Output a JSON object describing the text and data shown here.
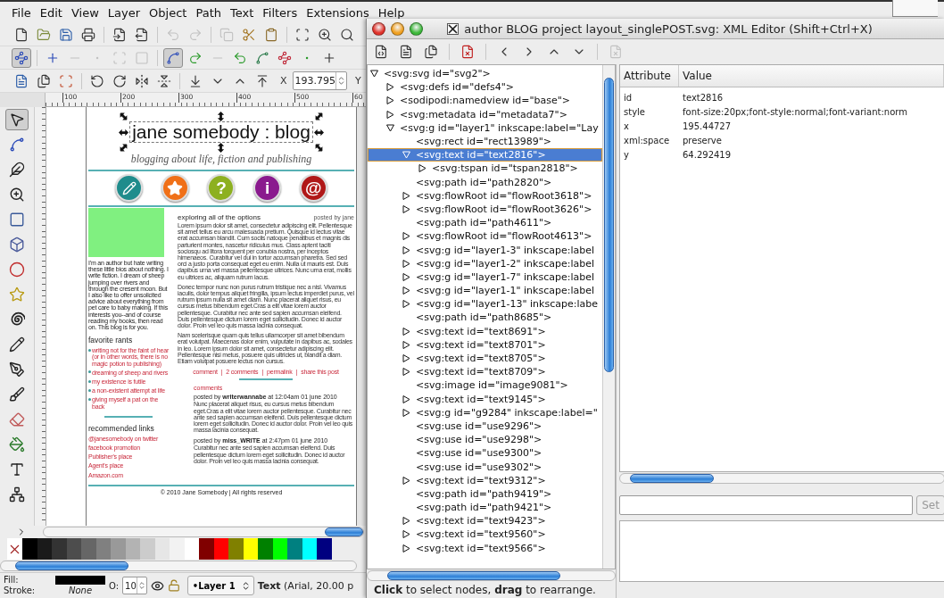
{
  "menu": [
    "File",
    "Edit",
    "View",
    "Layer",
    "Object",
    "Path",
    "Text",
    "Filters",
    "Extensions",
    "Help"
  ],
  "toolbar_main": [
    [
      {
        "kind": "new",
        "disabled": false
      },
      {
        "kind": "open",
        "disabled": false
      },
      {
        "kind": "save",
        "disabled": false
      },
      {
        "kind": "print",
        "disabled": false
      }
    ],
    [
      {
        "kind": "import",
        "disabled": false
      },
      {
        "kind": "export",
        "disabled": false
      }
    ],
    [
      {
        "kind": "undo",
        "disabled": true
      },
      {
        "kind": "redo",
        "disabled": true
      }
    ],
    [
      {
        "kind": "duplicate",
        "disabled": true
      },
      {
        "kind": "cut",
        "disabled": false
      },
      {
        "kind": "paste",
        "disabled": false
      }
    ],
    [
      {
        "kind": "zoom_selection",
        "disabled": false
      },
      {
        "kind": "zoom_drawing",
        "disabled": false
      },
      {
        "kind": "zoom_page",
        "disabled": false
      }
    ]
  ],
  "toolbar_node": [
    [
      {
        "kind": "node_edit",
        "pressed": true,
        "disabled": false
      }
    ],
    [
      {
        "kind": "insert_node",
        "pressed": false,
        "disabled": false
      },
      {
        "kind": "delete_node",
        "pressed": false,
        "disabled": true
      },
      {
        "kind": "join_nodes",
        "pressed": false,
        "disabled": true
      },
      {
        "kind": "break_nodes",
        "pressed": false,
        "disabled": true
      },
      {
        "kind": "join_segment",
        "pressed": false,
        "disabled": true
      }
    ],
    [
      {
        "kind": "cusp_node",
        "pressed": true,
        "disabled": false
      },
      {
        "kind": "smooth_node",
        "pressed": false,
        "disabled": false
      },
      {
        "kind": "symmetric_node",
        "pressed": false,
        "disabled": true
      },
      {
        "kind": "auto_node",
        "pressed": false,
        "disabled": false
      },
      {
        "kind": "to_line",
        "pressed": false,
        "disabled": false
      },
      {
        "kind": "to_curve",
        "pressed": false,
        "disabled": false
      },
      {
        "kind": "add_node",
        "pressed": false,
        "disabled": false
      },
      {
        "kind": "center_node",
        "pressed": false,
        "disabled": false
      }
    ]
  ],
  "toolbar_select": {
    "groups": [
      [
        {
          "kind": "select_all"
        },
        {
          "kind": "select_all_layers"
        },
        {
          "kind": "deselect"
        }
      ],
      [
        {
          "kind": "rotate_ccw"
        },
        {
          "kind": "rotate_cw"
        },
        {
          "kind": "flip_h"
        },
        {
          "kind": "flip_v"
        }
      ],
      [
        {
          "kind": "lower_bottom"
        },
        {
          "kind": "lower"
        },
        {
          "kind": "raise"
        },
        {
          "kind": "raise_top"
        }
      ]
    ],
    "x_label": "X",
    "x_value": "193.795",
    "y_label": "Y"
  },
  "ruler_labels": [
    "100",
    "200",
    "300",
    "400",
    "500",
    "60"
  ],
  "toolbox": [
    {
      "kind": "selector",
      "selected": true
    },
    {
      "kind": "node",
      "selected": false
    },
    {
      "kind": "tweak",
      "selected": false
    },
    {
      "kind": "zoom",
      "selected": false
    },
    {
      "kind": "rect",
      "selected": false
    },
    {
      "kind": "box3d",
      "selected": false
    },
    {
      "kind": "ellipse",
      "selected": false
    },
    {
      "kind": "star",
      "selected": false
    },
    {
      "kind": "spiral",
      "selected": false
    },
    {
      "kind": "pencil",
      "selected": false
    },
    {
      "kind": "pen",
      "selected": false
    },
    {
      "kind": "calligraphy",
      "selected": false
    },
    {
      "kind": "eraser",
      "selected": false
    },
    {
      "kind": "bucket",
      "selected": false
    },
    {
      "kind": "text",
      "selected": false
    },
    {
      "kind": "connector",
      "selected": false
    }
  ],
  "page": {
    "title": "jane somebody : blog",
    "subtitle": "blogging about life, fiction and publishing",
    "nav_icons": [
      {
        "kind": "pencil",
        "color": "#1f8c8c"
      },
      {
        "kind": "star",
        "color": "#f07018"
      },
      {
        "kind": "glyph",
        "glyph": "?",
        "color": "#8db020"
      },
      {
        "kind": "glyph",
        "glyph": "i",
        "color": "#8a1a8e"
      },
      {
        "kind": "glyph",
        "glyph": "@",
        "color": "#b01818"
      }
    ],
    "bio": "I'm an author but hate writing these little bios about nothing. I write fiction. I dream of sheep jumping over rivers and through the cresent moon. But I also like to offer unsolicited advice about everything from pet care to baby making. If this interests you--and of course reading my books, then read on. This blog is for you.",
    "rants_heading": "favorite rants",
    "rants": [
      "writing not for the faint of hear (or in other words, there is no magic potion to publishing)",
      "dreaming of sheep and rivers",
      "my existence is futile",
      "a non-existent attempt at life",
      "giving myself a pat on the back"
    ],
    "links_heading": "recommended links",
    "links": [
      "@janesomebody on twitter",
      "facebook promotion",
      "Publisher's place",
      "Agent's place",
      "Amazon.com"
    ],
    "post_heading": "exploring all of the options",
    "post_byline": "posted by jane",
    "paragraphs": [
      "Lorem ipsum dolor sit amet, consectetur adipiscing elit. Pellentesque sit amet tellus eu arcu malesuada pretium. Quisque id lectus vitae erat accumsan blandit. Cum sociis natoque penatibus et magnis dis parturient montes, nascetur ridiculus mus. Class aptent taciti sociosqu ad litora torquent per conubia nostra, per inceptos himenaeos. Curabitur vel dui in tortor accumsan pharetra. Sed sed orci a justo porta consequat eget eu enim. Nulla ut mauris est. Duis dapibus urna vel massa pellentesque ultrices. Nunc urna erat, mollis eu ultrices ac, aliquam rutrum lacus.",
      "Donec tempor nunc non purus rutrum tristique nec a nisl. Vivamus iaculis, dolor tempus aliquet fringilla, ipsum lectus imperdiet purus, vel rutrum ipsum nulla sit amet diam. Nunc placerat aliquet risus, eu cursus metus bibendum eget.Cras a elit vitae lorem auctor pellentesque. Curabitur nec ante sed sapien accumsan eleifend. Duis pellentesque dictum lorem eget sollicitudin. Donec id auctor dolor. Proin vel leo quis massa lacinia consequat.",
      "Nam scelerisque quam quis tellus ullamcorper sit amet bibendum erat volutpat. Maecenas dolor enim, vulputate in dapibus ac, sodales in leo. Lorem ipsum dolor sit amet, consectetur adipiscing elit. Pellentesque nisi metus, posuere quis ultricies ut, blandit a diam. Etiam volutpat posuere lectus non cursus."
    ],
    "post_links": [
      "comment",
      "2 comments",
      "permalink",
      "share this post"
    ],
    "link_separator": "|",
    "comments_label": "comments",
    "comments": [
      {
        "byline": "posted by **writerwannabe** at 12:04am  01 june 2010",
        "body": "Nunc placerat aliquet risus, eu cursus metus bibendum eget.Cras a elit vitae lorem auctor pellentesque. Curabitur nec ante sed sapien accumsan eleifend. Duis pellentesque dictum lorem eget sollicitudin. Donec id auctor dolor. Proin vel leo quis massa lacinia consequat."
      },
      {
        "byline": "posted by **miss_WRITE** at 2:47pm  01 june 2010",
        "body": "Curabitur nec ante sed sapien accumsan eleifend. Duis pellentesque dictum lorem eget sollicitudin. Donec id auctor dolor. Proin vel leo quis massa lacinia consequat."
      }
    ],
    "footer": "© 2010 Jane Somebody  | All rights reserved"
  },
  "palette": [
    {
      "color": "#000000"
    },
    {
      "color": "#1a1a1a"
    },
    {
      "color": "#333333"
    },
    {
      "color": "#4d4d4d"
    },
    {
      "color": "#666666"
    },
    {
      "color": "#808080"
    },
    {
      "color": "#999999"
    },
    {
      "color": "#b3b3b3"
    },
    {
      "color": "#cccccc"
    },
    {
      "color": "#e6e6e6"
    },
    {
      "color": "#f2f2f2"
    },
    {
      "color": "#ffffff"
    },
    {
      "color": "#800000"
    },
    {
      "color": "#ff0000"
    },
    {
      "color": "#808000"
    },
    {
      "color": "#ffff00"
    },
    {
      "color": "#008000"
    },
    {
      "color": "#00ff00"
    },
    {
      "color": "#008080"
    },
    {
      "color": "#00ffff"
    },
    {
      "color": "#000080"
    }
  ],
  "status": {
    "fill_label": "Fill:",
    "stroke_label": "Stroke:",
    "fill": {
      "color": "#000000"
    },
    "stroke_value": "None",
    "opacity_label": "O:",
    "opacity_value": "10",
    "layer": "•Layer 1",
    "message": "**Text** (Arial, 20.00 p"
  },
  "dialog": {
    "title": "author BLOG project layout_singlePOST.svg: XML Editor (Shift+Ctrl+X)",
    "toolbar": [
      [
        {
          "kind": "new_element",
          "disabled": false
        },
        {
          "kind": "new_text",
          "disabled": false
        },
        {
          "kind": "duplicate_node",
          "disabled": false
        }
      ],
      [
        {
          "kind": "delete_node",
          "disabled": false
        }
      ],
      [
        {
          "kind": "unindent",
          "disabled": false
        },
        {
          "kind": "indent",
          "disabled": false
        },
        {
          "kind": "raise",
          "disabled": false
        },
        {
          "kind": "lower",
          "disabled": false
        }
      ],
      [
        {
          "kind": "node_properties",
          "disabled": true
        }
      ]
    ],
    "tree": [
      {
        "label": "<svg:svg id=\"svg2\">",
        "expandable": true,
        "expanded": true,
        "selected": false,
        "children": [
          {
            "label": "<svg:defs id=\"defs4\">",
            "expandable": true,
            "expanded": false,
            "selected": false
          },
          {
            "label": "<sodipodi:namedview id=\"base\">",
            "expandable": true,
            "expanded": false,
            "selected": false
          },
          {
            "label": "<svg:metadata id=\"metadata7\">",
            "expandable": true,
            "expanded": false,
            "selected": false
          },
          {
            "label": "<svg:g id=\"layer1\" inkscape:label=\"Lay",
            "expandable": true,
            "expanded": true,
            "selected": false,
            "children": [
              {
                "label": "<svg:rect id=\"rect13989\">",
                "expandable": false,
                "selected": false
              },
              {
                "label": "<svg:text id=\"text2816\">",
                "expandable": true,
                "expanded": true,
                "selected": true,
                "children": [
                  {
                    "label": "<svg:tspan id=\"tspan2818\">",
                    "expandable": true,
                    "expanded": false,
                    "selected": false
                  }
                ]
              },
              {
                "label": "<svg:path id=\"path2820\">",
                "expandable": false,
                "selected": false
              },
              {
                "label": "<svg:flowRoot id=\"flowRoot3618\">",
                "expandable": true,
                "expanded": false,
                "selected": false
              },
              {
                "label": "<svg:flowRoot id=\"flowRoot3626\">",
                "expandable": true,
                "expanded": false,
                "selected": false
              },
              {
                "label": "<svg:path id=\"path4611\">",
                "expandable": false,
                "selected": false
              },
              {
                "label": "<svg:flowRoot id=\"flowRoot4613\">",
                "expandable": true,
                "expanded": false,
                "selected": false
              },
              {
                "label": "<svg:g id=\"layer1-3\" inkscape:label",
                "expandable": true,
                "expanded": false,
                "selected": false
              },
              {
                "label": "<svg:g id=\"layer1-2\" inkscape:label",
                "expandable": true,
                "expanded": false,
                "selected": false
              },
              {
                "label": "<svg:g id=\"layer1-7\" inkscape:label",
                "expandable": true,
                "expanded": false,
                "selected": false
              },
              {
                "label": "<svg:g id=\"layer1-1\" inkscape:label",
                "expandable": true,
                "expanded": false,
                "selected": false
              },
              {
                "label": "<svg:g id=\"layer1-13\" inkscape:labe",
                "expandable": true,
                "expanded": false,
                "selected": false
              },
              {
                "label": "<svg:path id=\"path8685\">",
                "expandable": false,
                "selected": false
              },
              {
                "label": "<svg:text id=\"text8691\">",
                "expandable": true,
                "expanded": false,
                "selected": false
              },
              {
                "label": "<svg:text id=\"text8701\">",
                "expandable": true,
                "expanded": false,
                "selected": false
              },
              {
                "label": "<svg:text id=\"text8705\">",
                "expandable": true,
                "expanded": false,
                "selected": false
              },
              {
                "label": "<svg:text id=\"text8709\">",
                "expandable": true,
                "expanded": false,
                "selected": false
              },
              {
                "label": "<svg:image id=\"image9081\">",
                "expandable": false,
                "selected": false
              },
              {
                "label": "<svg:text id=\"text9145\">",
                "expandable": true,
                "expanded": false,
                "selected": false
              },
              {
                "label": "<svg:g id=\"g9284\" inkscape:label=\"",
                "expandable": true,
                "expanded": false,
                "selected": false
              },
              {
                "label": "<svg:use id=\"use9296\">",
                "expandable": false,
                "selected": false
              },
              {
                "label": "<svg:use id=\"use9298\">",
                "expandable": false,
                "selected": false
              },
              {
                "label": "<svg:use id=\"use9300\">",
                "expandable": false,
                "selected": false
              },
              {
                "label": "<svg:use id=\"use9302\">",
                "expandable": false,
                "selected": false
              },
              {
                "label": "<svg:text id=\"text9312\">",
                "expandable": true,
                "expanded": false,
                "selected": false
              },
              {
                "label": "<svg:path id=\"path9419\">",
                "expandable": false,
                "selected": false
              },
              {
                "label": "<svg:path id=\"path9421\">",
                "expandable": false,
                "selected": false
              },
              {
                "label": "<svg:text id=\"text9423\">",
                "expandable": true,
                "expanded": false,
                "selected": false
              },
              {
                "label": "<svg:text id=\"text9560\">",
                "expandable": true,
                "expanded": false,
                "selected": false
              },
              {
                "label": "<svg:text id=\"text9566\">",
                "expandable": true,
                "expanded": false,
                "selected": false
              }
            ]
          }
        ]
      }
    ],
    "attributes": {
      "columns": [
        "Attribute",
        "Value"
      ],
      "rows": [
        {
          "name": "id",
          "value": "text2816"
        },
        {
          "name": "style",
          "value": "font-size:20px;font-style:normal;font-variant:norm"
        },
        {
          "name": "x",
          "value": "195.44727"
        },
        {
          "name": "xml:space",
          "value": "preserve"
        },
        {
          "name": "y",
          "value": "64.292419"
        }
      ]
    },
    "set_button": "Set",
    "status": "**Click** to select nodes, **drag** to rearrange."
  }
}
